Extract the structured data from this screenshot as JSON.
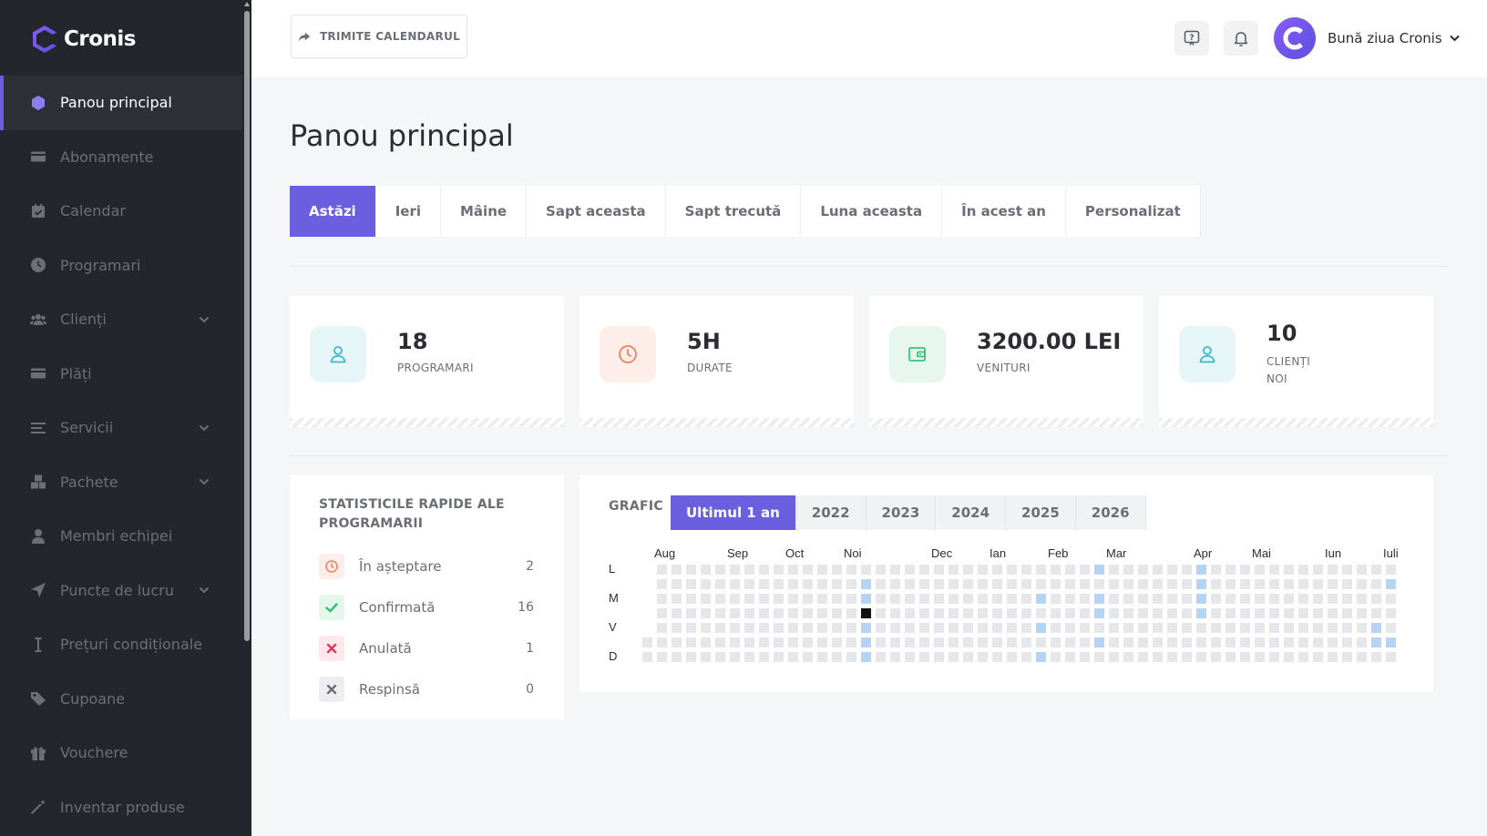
{
  "app": {
    "name": "Cronis"
  },
  "colors": {
    "accent": "#6b5fe0",
    "sidebar": "#24262d",
    "heat_empty": "#e6e7ea",
    "heat_active": "#b5d3f5",
    "heat_today": "#111111"
  },
  "sidebar": {
    "items": [
      {
        "label": "Panou principal",
        "icon": "cube-icon",
        "active": true,
        "expandable": false
      },
      {
        "label": "Abonamente",
        "icon": "card-icon",
        "active": false,
        "expandable": false
      },
      {
        "label": "Calendar",
        "icon": "calendar-icon",
        "active": false,
        "expandable": false
      },
      {
        "label": "Programari",
        "icon": "clock-icon",
        "active": false,
        "expandable": false
      },
      {
        "label": "Clienți",
        "icon": "users-icon",
        "active": false,
        "expandable": true
      },
      {
        "label": "Plăți",
        "icon": "card-icon",
        "active": false,
        "expandable": false
      },
      {
        "label": "Servicii",
        "icon": "list-icon",
        "active": false,
        "expandable": true
      },
      {
        "label": "Pachete",
        "icon": "boxes-icon",
        "active": false,
        "expandable": true
      },
      {
        "label": "Membri echipei",
        "icon": "user-icon",
        "active": false,
        "expandable": false
      },
      {
        "label": "Puncte de lucru",
        "icon": "location-arrow-icon",
        "active": false,
        "expandable": true
      },
      {
        "label": "Prețuri condiționale",
        "icon": "text-cursor-icon",
        "active": false,
        "expandable": false
      },
      {
        "label": "Cupoane",
        "icon": "tag-icon",
        "active": false,
        "expandable": false
      },
      {
        "label": "Vouchere",
        "icon": "gift-icon",
        "active": false,
        "expandable": false
      },
      {
        "label": "Inventar produse",
        "icon": "magic-wand-icon",
        "active": false,
        "expandable": false
      }
    ]
  },
  "topbar": {
    "share_label": "TRIMITE CALENDARUL",
    "greeting": "Bună ziua Cronis"
  },
  "main": {
    "title": "Panou principal",
    "tabs": [
      "Astăzi",
      "Ieri",
      "Mâine",
      "Sapt aceasta",
      "Sapt trecută",
      "Luna aceasta",
      "În acest an",
      "Personalizat"
    ],
    "active_tab": 0,
    "stats": [
      {
        "value": "18",
        "label": "PROGRAMARI",
        "icon": "user-icon"
      },
      {
        "value": "5H",
        "label": "DURATE",
        "icon": "clock-icon"
      },
      {
        "value": "3200.00 LEI",
        "label": "VENITURI",
        "icon": "wallet-icon"
      },
      {
        "value": "10",
        "label": "CLIENȚI NOI",
        "icon": "user-icon"
      }
    ],
    "quick_stats": {
      "title": "STATISTICILE RAPIDE ALE PROGRAMARII",
      "rows": [
        {
          "label": "În așteptare",
          "count": "2",
          "icon": "clock-icon"
        },
        {
          "label": "Confirmată",
          "count": "16",
          "icon": "check-icon"
        },
        {
          "label": "Anulată",
          "count": "1",
          "icon": "x-icon"
        },
        {
          "label": "Respinsă",
          "count": "0",
          "icon": "x-icon"
        }
      ]
    },
    "chart": {
      "label": "GRAFIC",
      "year_tabs": [
        "Ultimul 1 an",
        "2022",
        "2023",
        "2024",
        "2025",
        "2026"
      ],
      "active_year_tab": 0
    }
  },
  "chart_data": {
    "type": "heatmap",
    "months": [
      "Aug",
      "Sep",
      "Oct",
      "Noi",
      "Dec",
      "Ian",
      "Feb",
      "Mar",
      "Apr",
      "Mai",
      "Iun",
      "Iulie"
    ],
    "month_week_index": [
      1,
      6,
      10,
      14,
      20,
      24,
      28,
      32,
      38,
      42,
      47,
      51
    ],
    "day_labels": [
      "L",
      "M",
      "V",
      "D"
    ],
    "day_label_rows": [
      0,
      2,
      4,
      6
    ],
    "weeks": 53,
    "first_week_start_row": 5,
    "last_week_end_row": 6,
    "active_cells": [
      [
        15,
        1
      ],
      [
        15,
        2
      ],
      [
        15,
        4
      ],
      [
        15,
        5
      ],
      [
        15,
        6
      ],
      [
        27,
        2
      ],
      [
        27,
        4
      ],
      [
        27,
        6
      ],
      [
        31,
        0
      ],
      [
        31,
        2
      ],
      [
        31,
        3
      ],
      [
        31,
        5
      ],
      [
        38,
        0
      ],
      [
        38,
        1
      ],
      [
        38,
        2
      ],
      [
        38,
        3
      ],
      [
        50,
        4
      ],
      [
        50,
        5
      ],
      [
        51,
        1
      ],
      [
        51,
        5
      ]
    ],
    "today_cell": [
      15,
      3
    ]
  }
}
